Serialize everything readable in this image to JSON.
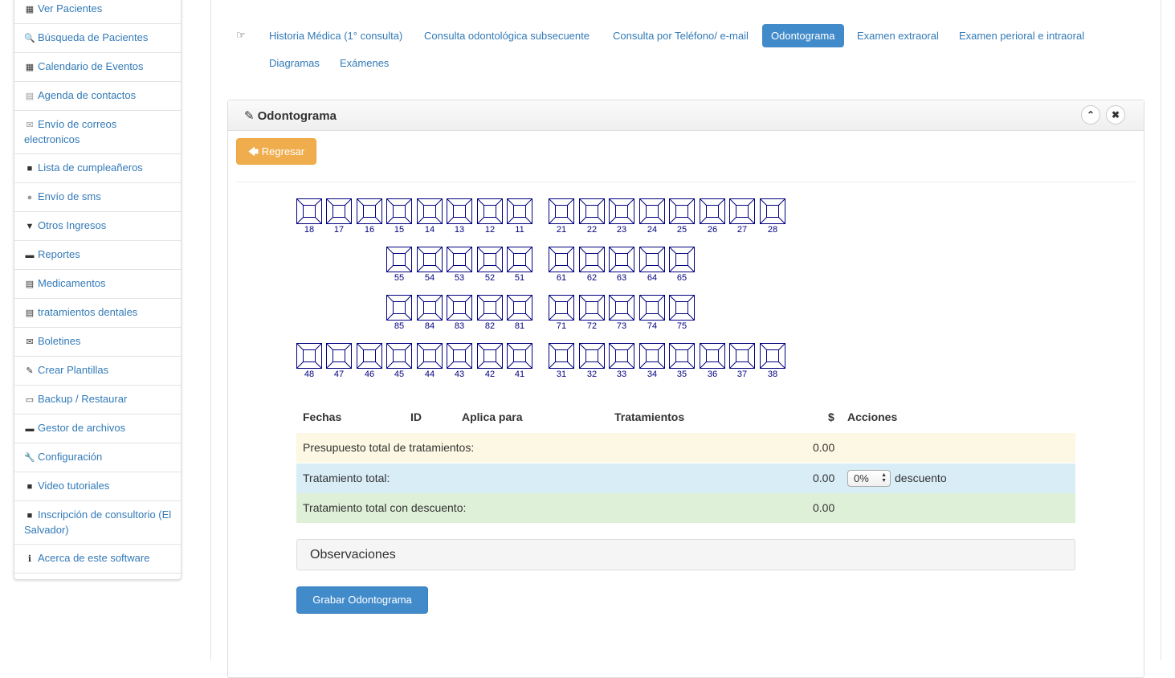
{
  "sidebar": {
    "items": [
      {
        "label": "Ver Pacientes",
        "icon": "grid-icon",
        "glyph": "▦"
      },
      {
        "label": "Búsqueda de Pacientes",
        "icon": "search-icon",
        "glyph": "🔍"
      },
      {
        "label": "Calendario de Eventos",
        "icon": "calendar-icon",
        "glyph": "▦"
      },
      {
        "label": "Agenda de contactos",
        "icon": "address-book-icon",
        "glyph": "▤"
      },
      {
        "label": "Envío de correos electronicos",
        "icon": "envelope-open-icon",
        "glyph": "✉"
      },
      {
        "label": "Lista de cumpleañeros",
        "icon": "gift-icon",
        "glyph": "■"
      },
      {
        "label": "Envío de sms",
        "icon": "comment-icon",
        "glyph": "●"
      },
      {
        "label": "Otros Ingresos",
        "icon": "shopping-cart-icon",
        "glyph": "▼"
      },
      {
        "label": "Reportes",
        "icon": "print-icon",
        "glyph": "▬"
      },
      {
        "label": "Medicamentos",
        "icon": "list-icon",
        "glyph": "▤"
      },
      {
        "label": "tratamientos dentales",
        "icon": "list-icon",
        "glyph": "▤"
      },
      {
        "label": "Boletines",
        "icon": "envelope-icon",
        "glyph": "✉"
      },
      {
        "label": "Crear Plantillas",
        "icon": "edit-icon",
        "glyph": "✎"
      },
      {
        "label": "Backup / Restaurar",
        "icon": "hdd-icon",
        "glyph": "▭"
      },
      {
        "label": "Gestor de archivos",
        "icon": "folder-icon",
        "glyph": "▬"
      },
      {
        "label": "Configuración",
        "icon": "wrench-icon",
        "glyph": "🔧"
      },
      {
        "label": "Video tutoriales",
        "icon": "video-camera-icon",
        "glyph": "■"
      },
      {
        "label": "Inscripción de consultorio (El Salvador)",
        "icon": "briefcase-icon",
        "glyph": "■"
      },
      {
        "label": "Acerca de este software",
        "icon": "info-circle-icon",
        "glyph": "ℹ"
      }
    ]
  },
  "tabs": [
    {
      "label": "Historia Médica (1° consulta)"
    },
    {
      "label": "Consulta odontológica subsecuente"
    },
    {
      "label": "Consulta por Teléfono/ e-mail"
    },
    {
      "label": "Odontograma"
    },
    {
      "label": "Examen extraoral"
    },
    {
      "label": "Examen perioral e intraoral"
    },
    {
      "label": "Diagramas"
    },
    {
      "label": "Exámenes"
    }
  ],
  "active_tab": "Odontograma",
  "panel": {
    "title": "Odontograma",
    "back_button": "Regresar"
  },
  "odontogram": {
    "rows": [
      {
        "left": [
          "18",
          "17",
          "16",
          "15",
          "14",
          "13",
          "12",
          "11"
        ],
        "right": [
          "21",
          "22",
          "23",
          "24",
          "25",
          "26",
          "27",
          "28"
        ]
      },
      {
        "left": [
          "55",
          "54",
          "53",
          "52",
          "51"
        ],
        "right": [
          "61",
          "62",
          "63",
          "64",
          "65"
        ]
      },
      {
        "left": [
          "85",
          "84",
          "83",
          "82",
          "81"
        ],
        "right": [
          "71",
          "72",
          "73",
          "74",
          "75"
        ]
      },
      {
        "left": [
          "48",
          "47",
          "46",
          "45",
          "44",
          "43",
          "42",
          "41"
        ],
        "right": [
          "31",
          "32",
          "33",
          "34",
          "35",
          "36",
          "37",
          "38"
        ]
      }
    ]
  },
  "table": {
    "headers": {
      "fechas": "Fechas",
      "id": "ID",
      "aplica": "Aplica para",
      "tratamientos": "Tratamientos",
      "monto": "$",
      "acciones": "Acciones"
    },
    "rows": [
      {
        "label": "Presupuesto total de tratamientos:",
        "value": "0.00",
        "color": "#fcf8e3"
      },
      {
        "label": "Tratamiento total:",
        "value": "0.00",
        "color": "#d9edf7",
        "discount_value": "0%",
        "discount_label": "descuento"
      },
      {
        "label": "Tratamiento total con descuento:",
        "value": "0.00",
        "color": "#dff0d8"
      }
    ]
  },
  "observaciones": "Observaciones",
  "save_button": "Grabar Odontograma",
  "colors": {
    "accent": "#428bca",
    "warning": "#f0ad4e",
    "tooth_stroke": "#000080"
  }
}
